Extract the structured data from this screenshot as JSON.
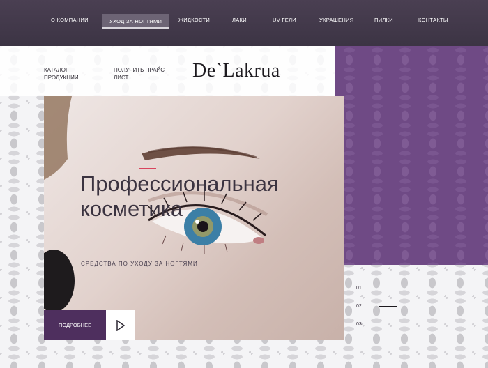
{
  "nav": {
    "items": [
      {
        "label": "О КОМПАНИИ"
      },
      {
        "label": "УХОД ЗА НОГТЯМИ"
      },
      {
        "label": "ЖИДКОСТИ"
      },
      {
        "label": "ЛАКИ"
      },
      {
        "label": "UV ГЕЛИ"
      },
      {
        "label": "УКРАШЕНИЯ"
      },
      {
        "label": "ПИЛКИ"
      },
      {
        "label": "КОНТАКТЫ"
      }
    ],
    "active_index": 1
  },
  "header": {
    "catalog_line1": "КАТАЛОГ",
    "catalog_line2": "ПРОДУКЦИИ",
    "price_line1": "ПОЛУЧИТЬ ПРАЙС",
    "price_line2": "ЛИСТ",
    "logo": "De`Lakrua"
  },
  "hero": {
    "title_line1": "Профессиональная",
    "title_line2": "косметика",
    "subtitle": "СРЕДСТВА ПО УХОДУ ЗА НОГТЯМИ",
    "more_button": "ПОДРОБНЕЕ"
  },
  "slider": {
    "pages": [
      "01",
      "02",
      "03"
    ],
    "current": 1
  },
  "colors": {
    "nav_bg": "#3c3444",
    "accent_purple": "#6f4a85",
    "button_purple": "#4e2f5e",
    "accent_red": "#d9455e"
  }
}
